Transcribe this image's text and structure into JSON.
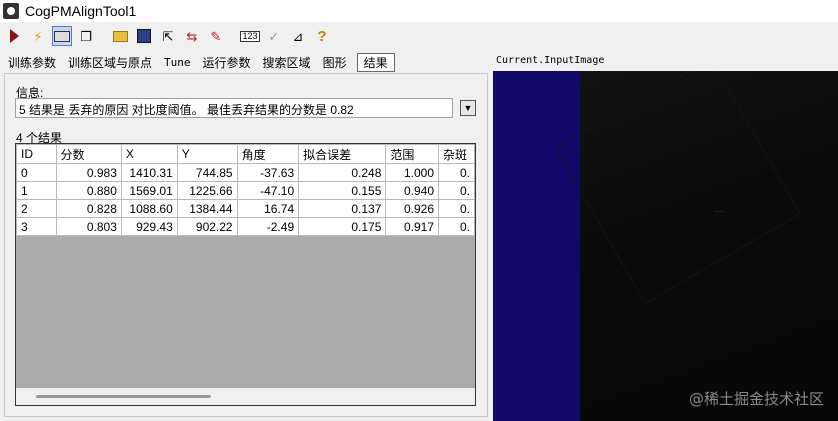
{
  "window": {
    "title": "CogPMAlignTool1"
  },
  "toolbar": {
    "buttons": [
      {
        "name": "run-icon"
      },
      {
        "name": "electric-icon"
      },
      {
        "name": "show-results-icon"
      },
      {
        "name": "copy-icon"
      },
      {
        "name": "open-folder-icon"
      },
      {
        "name": "save-icon"
      },
      {
        "name": "export-icon"
      },
      {
        "name": "import-icon"
      },
      {
        "name": "reset-icon"
      },
      {
        "name": "counter-icon",
        "label": "123"
      },
      {
        "name": "check-icon"
      },
      {
        "name": "measure-icon"
      },
      {
        "name": "help-icon",
        "label": "?"
      }
    ]
  },
  "tabs": [
    "训练参数",
    "训练区域与原点",
    "Tune",
    "运行参数",
    "搜索区域",
    "图形",
    "结果"
  ],
  "active_tab": "结果",
  "info": {
    "label": "信息:",
    "message": "5 结果是 丢弃的原因 对比度阈值。  最佳丢弃结果的分数是 0.82"
  },
  "results": {
    "count_label": "4 个结果",
    "columns": [
      "ID",
      "分数",
      "X",
      "Y",
      "角度",
      "拟合误差",
      "范围",
      "杂斑"
    ],
    "rows": [
      [
        "0",
        "0.983",
        "1410.31",
        "744.85",
        "-37.63",
        "0.248",
        "1.000",
        "0."
      ],
      [
        "1",
        "0.880",
        "1569.01",
        "1225.66",
        "-47.10",
        "0.155",
        "0.940",
        "0."
      ],
      [
        "2",
        "0.828",
        "1088.60",
        "1384.44",
        "16.74",
        "0.137",
        "0.926",
        "0."
      ],
      [
        "3",
        "0.803",
        "929.43",
        "902.22",
        "-2.49",
        "0.175",
        "0.917",
        "0."
      ]
    ]
  },
  "image": {
    "label": "Current.InputImage",
    "watermark": "@稀土掘金技术社区"
  }
}
